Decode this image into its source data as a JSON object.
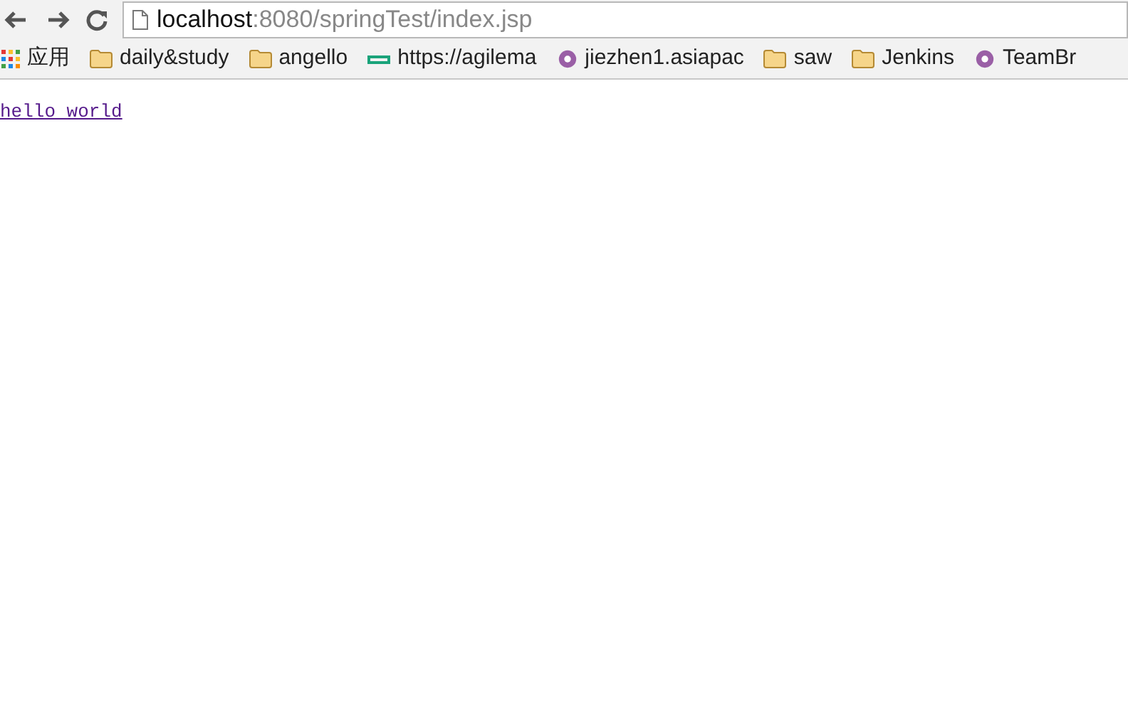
{
  "address_bar": {
    "host": "localhost",
    "path": ":8080/springTest/index.jsp"
  },
  "bookmarks": [
    {
      "kind": "apps",
      "label": "应用"
    },
    {
      "kind": "folder",
      "label": "daily&study"
    },
    {
      "kind": "folder",
      "label": "angello"
    },
    {
      "kind": "link",
      "label": "https://agilema"
    },
    {
      "kind": "site",
      "label": "jiezhen1.asiapac"
    },
    {
      "kind": "folder",
      "label": "saw"
    },
    {
      "kind": "folder",
      "label": "Jenkins"
    },
    {
      "kind": "site",
      "label": "TeamBr"
    }
  ],
  "page": {
    "link": "hello world"
  }
}
